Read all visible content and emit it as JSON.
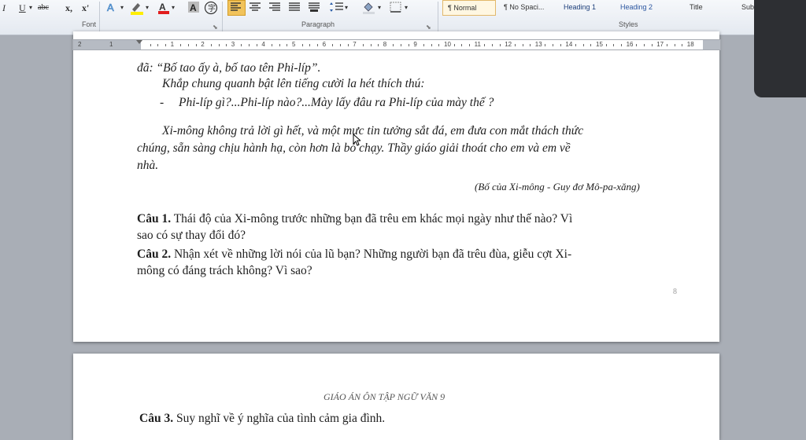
{
  "ribbon": {
    "font_buttons": [
      "I",
      "U",
      "abc",
      "x,",
      "x'"
    ],
    "group_font": "Font",
    "group_paragraph": "Paragraph",
    "group_styles": "Styles",
    "styles": [
      "¶ Normal",
      "¶ No Spaci...",
      "Heading 1",
      "Heading 2",
      "Title",
      "Sub"
    ]
  },
  "ruler": {
    "left_numbers": [
      "2",
      "1"
    ],
    "numbers": [
      "1",
      "2",
      "3",
      "4",
      "5",
      "6",
      "7",
      "8",
      "9",
      "10",
      "11",
      "12",
      "13",
      "14",
      "15",
      "16",
      "17",
      "18"
    ]
  },
  "page1": {
    "lines": [
      "đã: “Bố tao ấy à, bố tao tên Phi-líp”.",
      "Khắp chung quanh bật lên tiếng cười la hét thích thú:",
      "-",
      "Phi-líp gì?...Phi-líp nào?...Mày lấy đâu ra Phi-líp của mày thế ?",
      "Xi-mông không trả lời gì hết, và một mực tin tưởng sắt đá, em đưa con mắt thách thức",
      "chúng, sẵn sàng chịu hành hạ, còn hơn là bỏ chạy. Thầy giáo giải thoát cho em và em về",
      "nhà."
    ],
    "citation": "(Bố của Xi-mông - Guy đơ Mô-pa-xăng)",
    "q1_label": "Câu 1.",
    "q1_line1": "Thái độ của Xi-mông trước những bạn đã trêu em khác mọi ngày như thế nào? Vì",
    "q1_line2": "sao có sự thay đổi đó?",
    "q2_label": "Câu 2.",
    "q2_line1": "Nhận xét về những lời nói của lũ bạn? Những người bạn đã trêu đùa, giễu cợt Xi-",
    "q2_line2": "mông có đáng trách không? Vì sao?",
    "page_number": "8"
  },
  "page2": {
    "header": "GIÁO ÁN ÔN TẬP NGỮ VĂN 9",
    "q3_label": "Câu 3.",
    "q3_text": "Suy nghĩ về ý nghĩa của tình cảm gia đình."
  },
  "colors": {
    "background": "#a9aeb6",
    "ribbon": "#e4e9f0",
    "selected_button": "#f1c35b",
    "dark_panel": "#2d2f33"
  }
}
